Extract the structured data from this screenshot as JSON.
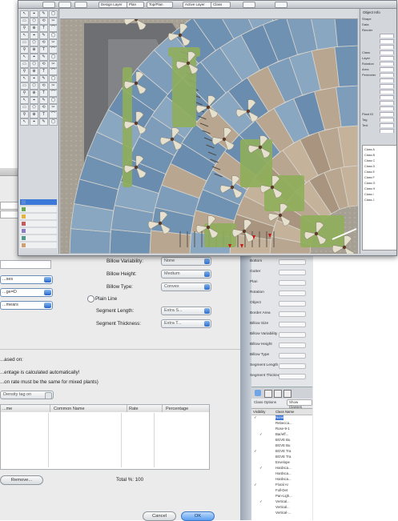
{
  "dialog": {
    "variability_label": "Billow Variability:",
    "variability_value": "None",
    "height_label": "Billow Height:",
    "height_value": "Medium",
    "type_label": "Billow Type:",
    "type_value": "Convex",
    "plain_line_label": "Plain Line",
    "segment_length_label": "Segment Length:",
    "segment_length_value": "Extra S...",
    "segment_thickness_label": "Segment Thickness:",
    "segment_thickness_value": "Extra T...",
    "left_selects": [
      "...ses",
      "...ge=D",
      "...mears"
    ],
    "based_on_text": "...ased on:",
    "check1_text": "...entage is calculated automatically!",
    "check2_text": "...on rate must be the same for mixed plants)",
    "density_select": "Density tag on",
    "table_headers": [
      "...me",
      "Common Name",
      "Rate",
      "Percentage"
    ],
    "remove_button": "Remove...",
    "total_label": "Total %: 100",
    "cancel_button": "Cancel",
    "ok_button": "OK"
  },
  "right_lower": {
    "rows": [
      "Bottom",
      "Gutter",
      "Plan",
      "Rotation",
      "Object",
      "Border Area",
      "Billow Size",
      "Billow Variability",
      "Billow Height",
      "Billow Type",
      "Segment Length",
      "Segment Thickness"
    ],
    "tabs_label": "Class Options",
    "show_label": "Show Classes",
    "list_headers": [
      "Visibility",
      "Class Name"
    ],
    "list_items": [
      "None",
      "Rebecca...",
      "Rose-9-1",
      "Bar/eff...",
      "BGVE Bu",
      "BGVE Bu",
      "BGVE Tra",
      "BGVE Tra",
      "Envelope",
      "Hardsca...",
      "Hardsca...",
      "Hardsca...",
      "Floral Ar",
      "Full-Det",
      "Pan-Ligh...",
      "Vertical...",
      "Vertical...",
      "Vertical-..."
    ]
  },
  "top_window": {
    "menu_buttons": [
      "",
      "",
      "",
      "Design Layer",
      "Plan",
      "Top/Plan",
      "Active Layer",
      "Class",
      "",
      ""
    ],
    "tab_labels": [
      "",
      "",
      "",
      "",
      "",
      ""
    ],
    "right_panel_title": "Object Info",
    "right_panel_rows": [
      "Shape",
      "Data",
      "Render",
      "",
      "",
      "",
      "Class",
      "Layer",
      "Rotation",
      "Area",
      "Perimeter",
      "",
      "",
      "",
      "",
      "",
      "",
      "Plant ID",
      "Tag",
      "Text",
      ""
    ],
    "class_list": [
      "Class A",
      "Class B",
      "Class C",
      "Class D",
      "Class E",
      "Class F",
      "Class G",
      "Class H",
      "Class I",
      "Class J"
    ]
  }
}
